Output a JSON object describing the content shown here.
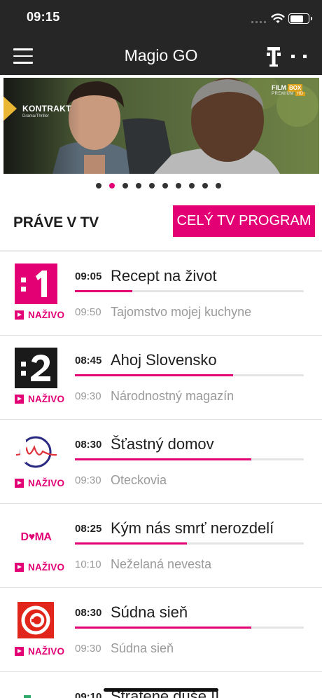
{
  "status_bar": {
    "time": "09:15"
  },
  "header": {
    "title": "Magio GO"
  },
  "hero": {
    "title": "KONTRAKT",
    "genre": "Drama/Thriller",
    "channel_line1": "FILM",
    "channel_line1b": "BOX",
    "channel_line2": "PREMIUM",
    "channel_line2b": "HD",
    "dots_total": 10,
    "dots_active_index": 1
  },
  "section": {
    "title": "PRÁVE V TV",
    "button_label": "CELÝ TV PROGRAM"
  },
  "channels": [
    {
      "logo": "jednotka-logo",
      "logo_text": ":1",
      "live_label": "NAŽIVO",
      "now_time": "09:05",
      "now_title": "Recept na život",
      "progress": 0.25,
      "next_time": "09:50",
      "next_title": "Tajomstvo mojej kuchyne"
    },
    {
      "logo": "dvojka-logo",
      "logo_text": ":2",
      "live_label": "NAŽIVO",
      "now_time": "08:45",
      "now_title": "Ahoj Slovensko",
      "progress": 0.69,
      "next_time": "09:30",
      "next_title": "Národnostný magazín"
    },
    {
      "logo": "markiza-logo",
      "logo_text": "",
      "live_label": "NAŽIVO",
      "now_time": "08:30",
      "now_title": "Šťastný domov",
      "progress": 0.77,
      "next_time": "09:30",
      "next_title": "Oteckovia"
    },
    {
      "logo": "doma-logo",
      "logo_text": "DOMA",
      "live_label": "NAŽIVO",
      "now_time": "08:25",
      "now_title": "Kým nás smrť nerozdelí",
      "progress": 0.49,
      "next_time": "10:10",
      "next_title": "Neželaná nevesta"
    },
    {
      "logo": "joj-logo",
      "logo_text": "",
      "live_label": "NAŽIVO",
      "now_time": "08:30",
      "now_title": "Súdna sieň",
      "progress": 0.77,
      "next_time": "09:30",
      "next_title": "Súdna sieň"
    }
  ],
  "partial_row": {
    "now_time": "09:10",
    "now_title": "Stratené duše II"
  },
  "colors": {
    "accent": "#e20074",
    "header_bg": "#262626",
    "muted_text": "#9a9a9a"
  }
}
